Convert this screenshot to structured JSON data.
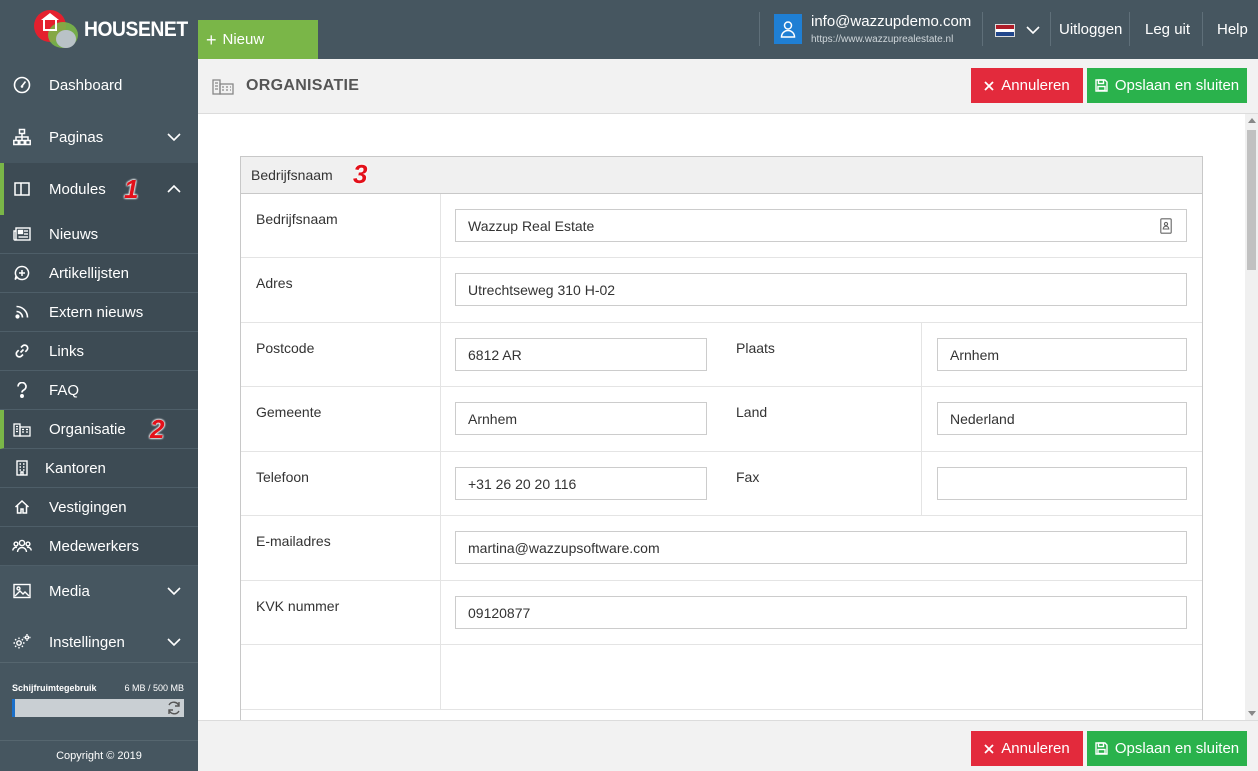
{
  "app": {
    "logo_text": "HOUSENET",
    "new_button": "Nieuw",
    "user_email": "info@wazzupdemo.com",
    "user_site": "https://www.wazzuprealestate.nl",
    "logout": "Uitloggen",
    "explain": "Leg uit",
    "help": "Help"
  },
  "sidebar": {
    "dashboard": "Dashboard",
    "paginas": "Paginas",
    "modules": "Modules",
    "sub": {
      "nieuws": "Nieuws",
      "artikellijsten": "Artikellijsten",
      "extern_nieuws": "Extern nieuws",
      "links": "Links",
      "faq": "FAQ",
      "organisatie": "Organisatie",
      "kantoren": "Kantoren",
      "vestigingen": "Vestigingen",
      "medewerkers": "Medewerkers"
    },
    "media": "Media",
    "instellingen": "Instellingen",
    "disk_label": "Schijfruimtegebruik",
    "disk_value": "6 MB / 500 MB",
    "disk_fraction": 0.012,
    "copyright": "Copyright © 2019"
  },
  "annotations": {
    "a1": "1",
    "a2": "2",
    "a3": "3"
  },
  "page": {
    "title": "ORGANISATIE",
    "cancel": "Annuleren",
    "save": "Opslaan en sluiten"
  },
  "form": {
    "section_title": "Bedrijfsnaam",
    "fields": {
      "bedrijfsnaam": {
        "label": "Bedrijfsnaam",
        "value": "Wazzup Real Estate"
      },
      "adres": {
        "label": "Adres",
        "value": "Utrechtseweg 310 H-02"
      },
      "postcode": {
        "label": "Postcode",
        "value": "6812 AR"
      },
      "plaats": {
        "label": "Plaats",
        "value": "Arnhem"
      },
      "gemeente": {
        "label": "Gemeente",
        "value": "Arnhem"
      },
      "land": {
        "label": "Land",
        "value": "Nederland"
      },
      "telefoon": {
        "label": "Telefoon",
        "value": "+31 26 20 20 116"
      },
      "fax": {
        "label": "Fax",
        "value": ""
      },
      "email": {
        "label": "E-mailadres",
        "value": "martina@wazzupsoftware.com"
      },
      "kvk": {
        "label": "KVK nummer",
        "value": "09120877"
      }
    }
  },
  "colors": {
    "sidebar_bg": "#465660",
    "accent_green": "#7ab648",
    "cancel_red": "#e32a3c",
    "save_green": "#2ab24c",
    "user_blue": "#1f7fd4"
  }
}
